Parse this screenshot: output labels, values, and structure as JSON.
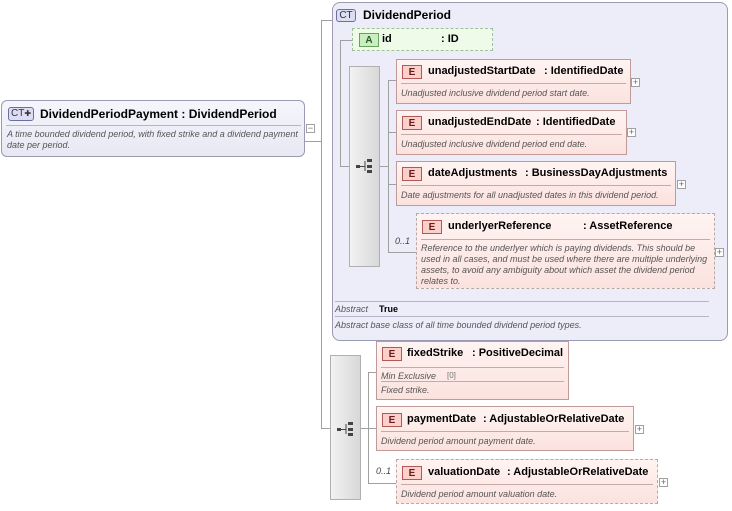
{
  "main_type": {
    "tag": "CT",
    "title": "DividendPeriodPayment : DividendPeriod",
    "description": "A time bounded dividend period, with fixed strike and a dividend payment date per period."
  },
  "base_type": {
    "tag": "CT",
    "title": "DividendPeriod",
    "attribute": {
      "tag": "A",
      "name": "id",
      "type": ": ID"
    },
    "elements": [
      {
        "tag": "E",
        "name": "unadjustedStartDate",
        "type": ": IdentifiedDate",
        "description": "Unadjusted inclusive dividend period start date.",
        "cardinality": ""
      },
      {
        "tag": "E",
        "name": "unadjustedEndDate",
        "type": ": IdentifiedDate",
        "description": "Unadjusted inclusive dividend period end date.",
        "cardinality": ""
      },
      {
        "tag": "E",
        "name": "dateAdjustments",
        "type": ": BusinessDayAdjustments",
        "description": "Date adjustments for all unadjusted dates in this dividend period.",
        "cardinality": ""
      },
      {
        "tag": "E",
        "name": "underlyerReference",
        "type": ": AssetReference",
        "description": "Reference to the underlyer which is paying dividends. This should be used in all cases, and must be used where there are multiple underlying assets, to avoid any ambiguity about which asset the dividend period relates to.",
        "cardinality": "0..1"
      }
    ],
    "abstract_label": "Abstract",
    "abstract_value": "True",
    "description": "Abstract base class of all time bounded dividend period types."
  },
  "extension_elements": [
    {
      "tag": "E",
      "name": "fixedStrike",
      "type": ": PositiveDecimal",
      "facet_label": "Min Exclusive",
      "facet_value": "[0]",
      "description": "Fixed strike.",
      "cardinality": ""
    },
    {
      "tag": "E",
      "name": "paymentDate",
      "type": ": AdjustableOrRelativeDate",
      "description": "Dividend period amount payment date.",
      "cardinality": ""
    },
    {
      "tag": "E",
      "name": "valuationDate",
      "type": ": AdjustableOrRelativeDate",
      "description": "Dividend period amount valuation date.",
      "cardinality": "0..1"
    }
  ],
  "expand_symbol": "+",
  "collapse_symbol": "−"
}
